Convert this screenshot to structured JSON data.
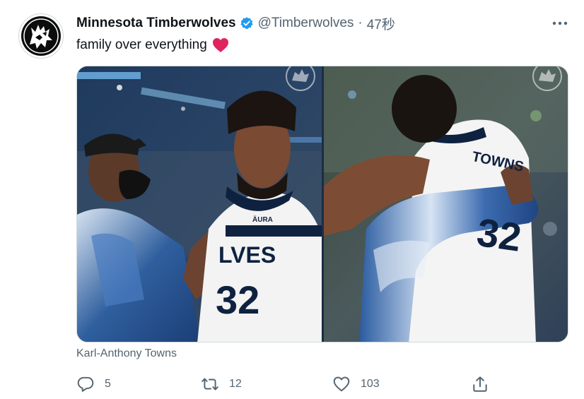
{
  "tweet": {
    "display_name": "Minnesota Timberwolves",
    "handle": "@Timberwolves",
    "separator": "·",
    "time": "47秒",
    "text": "family over everything",
    "emoji": "heart-emoji",
    "media_caption": "Karl-Anthony Towns",
    "photos": [
      {
        "jersey_logo": "ÄURA",
        "jersey_text": "LVES",
        "jersey_number": "32"
      },
      {
        "jersey_name": "TOWNS",
        "jersey_number": "32"
      }
    ]
  },
  "actions": {
    "replies": "5",
    "retweets": "12",
    "likes": "103"
  },
  "icons": {
    "avatar": "timberwolves-logo-icon",
    "verified": "verified-badge-icon",
    "more": "more-icon",
    "reply": "reply-icon",
    "retweet": "retweet-icon",
    "like": "like-icon",
    "share": "share-icon"
  },
  "colors": {
    "verified": "#1d9bf0",
    "heart": "#e0245e",
    "secondary_text": "#536471",
    "primary_text": "#0f1419"
  }
}
